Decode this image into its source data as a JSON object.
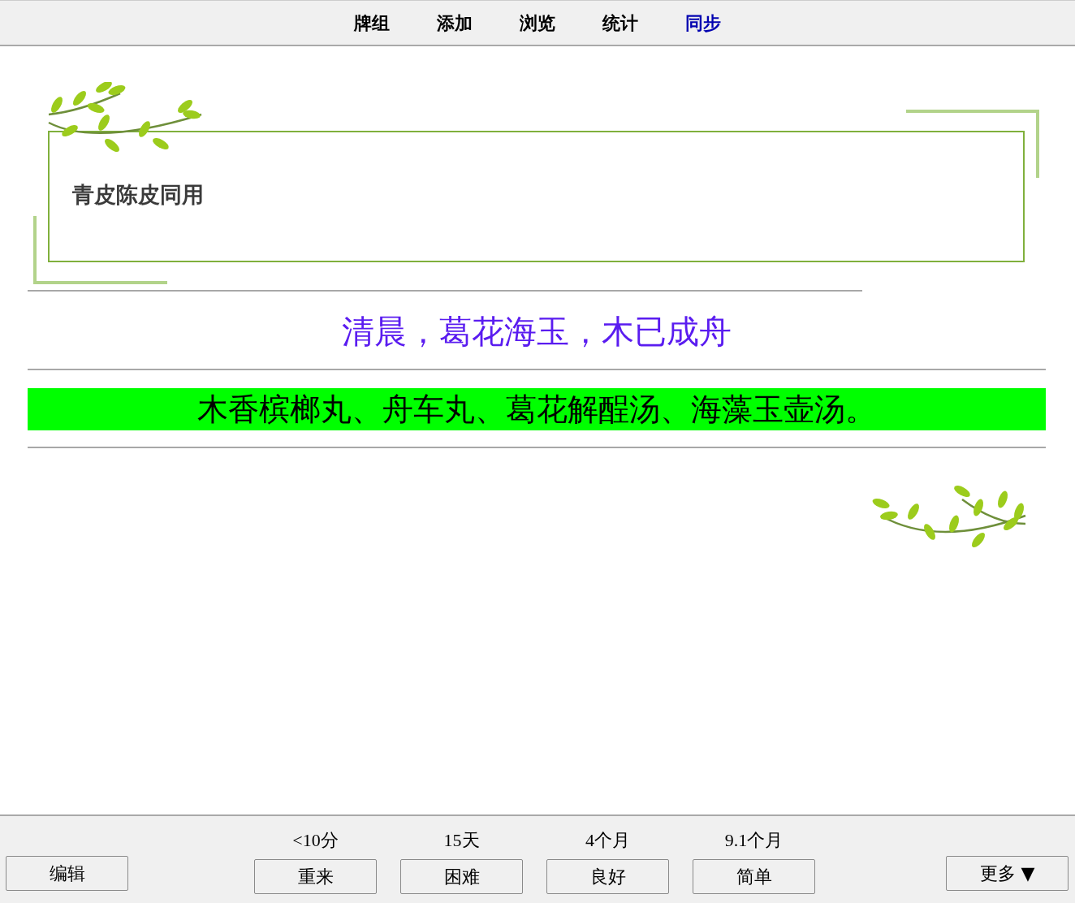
{
  "nav": [
    {
      "label": "牌组",
      "highlighted": false
    },
    {
      "label": "添加",
      "highlighted": false
    },
    {
      "label": "浏览",
      "highlighted": false
    },
    {
      "label": "统计",
      "highlighted": false
    },
    {
      "label": "同步",
      "highlighted": true
    }
  ],
  "card": {
    "front": "青皮陈皮同用",
    "mnemonic": "清晨，葛花海玉，木已成舟",
    "answer": "木香槟榔丸、舟车丸、葛花解酲汤、海藻玉壶汤。"
  },
  "bottom_bar": {
    "edit_button": "编辑",
    "answers": [
      {
        "interval": "<10分",
        "label": "重来"
      },
      {
        "interval": "15天",
        "label": "困难"
      },
      {
        "interval": "4个月",
        "label": "良好"
      },
      {
        "interval": "9.1个月",
        "label": "简单"
      }
    ],
    "more_button": "更多 ▼"
  }
}
